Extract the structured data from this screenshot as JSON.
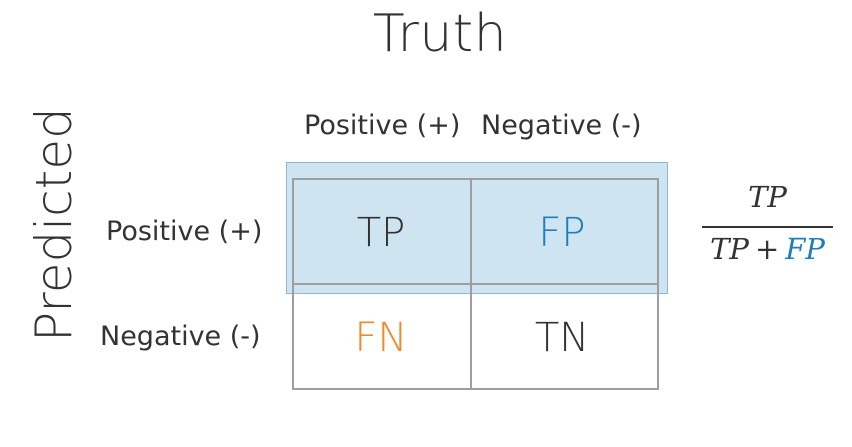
{
  "title": "Truth",
  "axis_label": "Predicted",
  "columns": [
    "Positive (+)",
    "Negative (-)"
  ],
  "rows": [
    "Positive (+)",
    "Negative (-)"
  ],
  "cells": {
    "tp": "TP",
    "fp": "FP",
    "fn": "FN",
    "tn": "TN"
  },
  "formula": {
    "numerator": "TP",
    "denominator_left": "TP",
    "operator": "+",
    "denominator_right": "FP"
  },
  "colors": {
    "fp_color": "#1f7fb8",
    "fn_color": "#ee8a2a",
    "highlight": "#7eb8da"
  }
}
